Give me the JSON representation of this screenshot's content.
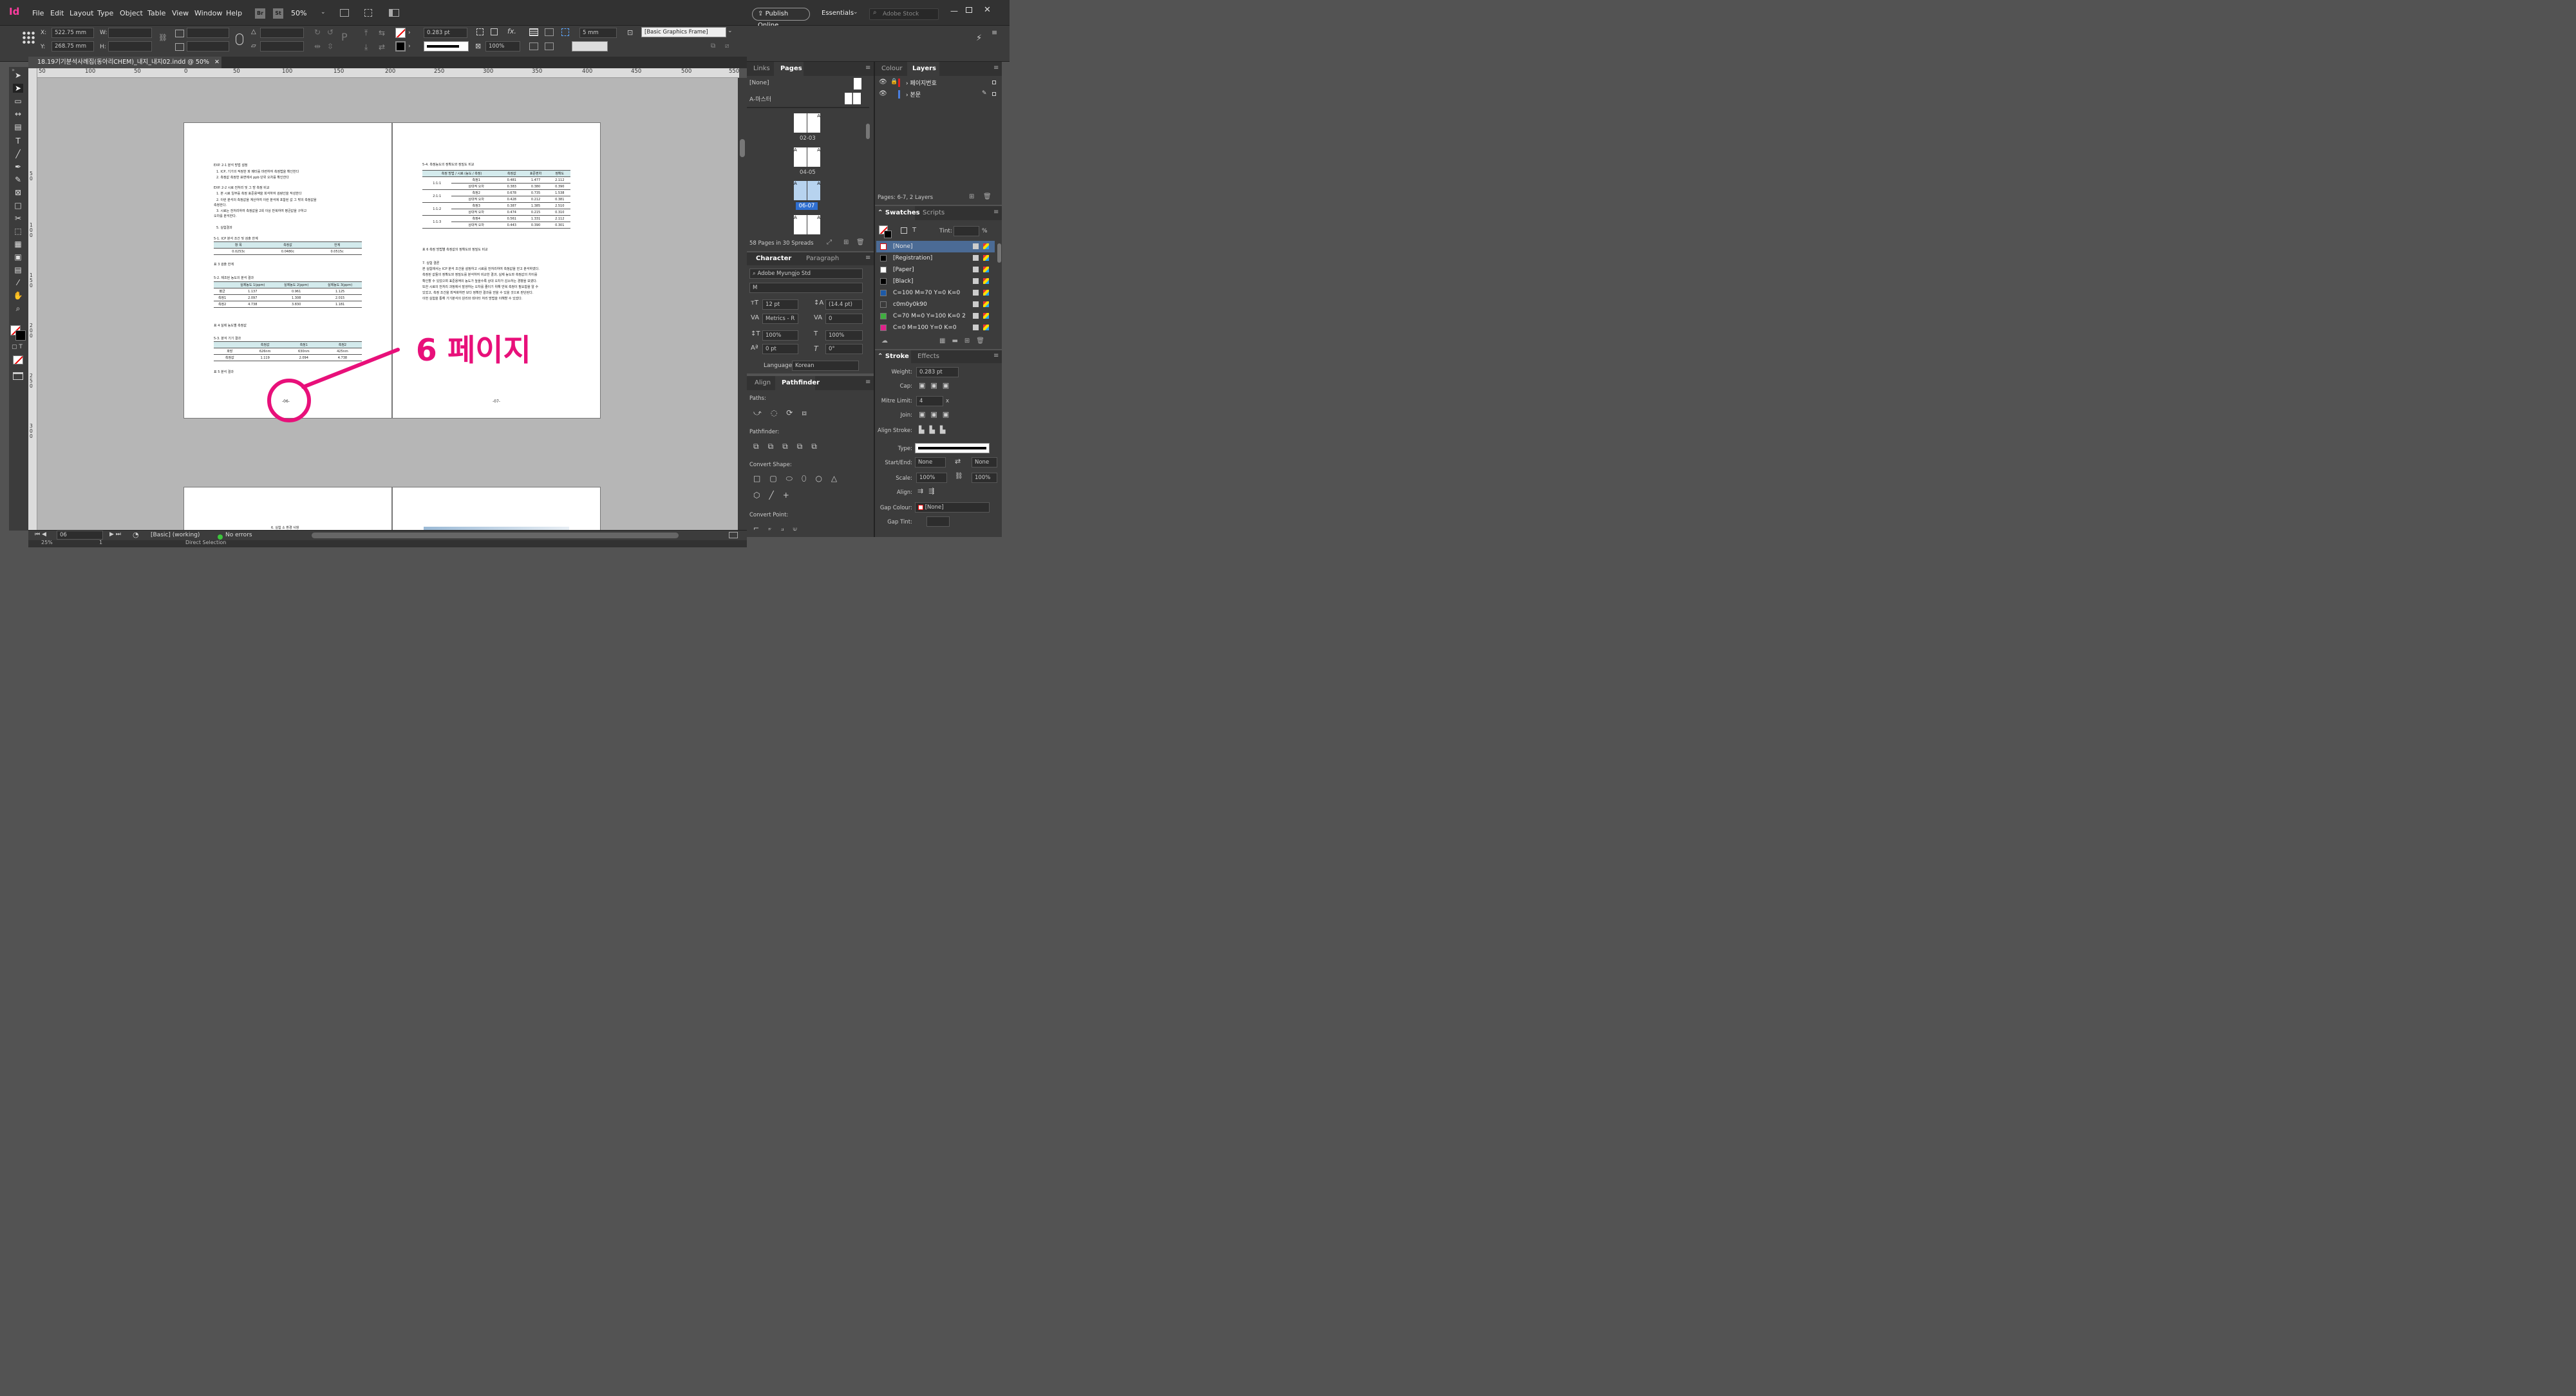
{
  "app": {
    "logo": "Id",
    "menu": [
      "File",
      "Edit",
      "Layout",
      "Type",
      "Object",
      "Table",
      "View",
      "Window",
      "Help"
    ],
    "bridge": "Br",
    "stock": "St",
    "zoom": "50%",
    "publish": "Publish Online",
    "workspace": "Essentials",
    "search_placeholder": "Adobe Stock"
  },
  "control": {
    "x_label": "X:",
    "x": "522.75 mm",
    "y_label": "Y:",
    "y": "268.75 mm",
    "w_label": "W:",
    "h_label": "H:",
    "stroke_weight": "0.283 pt",
    "opacity": "100%",
    "corner": "5 mm",
    "frame_style": "[Basic Graphics Frame]"
  },
  "doc": {
    "tab": "18.19기기분석사례집(동아리CHEM)_내지_내지02.indd @ 50%"
  },
  "rulers": {
    "h": [
      "50",
      "100",
      "50",
      "0",
      "50",
      "100",
      "150",
      "200",
      "250",
      "300",
      "350",
      "400",
      "450",
      "500",
      "550"
    ],
    "v": [
      "5 0",
      "1 0 0",
      "1 5 0",
      "2 0 0",
      "2 5 0",
      "3 0 0"
    ]
  },
  "left_page": {
    "lines": [
      "EXP. 2-1 분석 방법 설정",
      "1. ICP, 기기의 적정한 파 메터를 마련하여 측정법을 확인한다",
      "2. 측정값 측정한 표면에서 ppb 단위 오차를 확인한다",
      "EXP. 2-2 시료 전처리 및 그 방 측정 비교",
      "1. 본 시료 일부를 측정 표준용액을 희석하여 검량선을 작성한다",
      "2. 이런 분석의 측정값을 계산하여 이런 분석에 포함된 값 그 밖의 측정값을",
      "측정한다.",
      "3. 시료는 전처리하여 측정값을 2회 이상 반복하여 평균값을 구하고",
      "오차를 분석한다.",
      "5. 실험결과",
      "5-1. ICP 분석 조건 및 검출 한계",
      "표 3 검출 한계",
      "5-2. 제조된 농도의 분석 결과",
      "표 4 실제 농도별 측정값",
      "5-3. 분석 기기 결과",
      "표 5 분석 결과"
    ],
    "table1": [
      [
        "항 목",
        "측정값",
        "한계"
      ],
      [
        "0.0253c",
        "0.0480c",
        "0.0515c"
      ]
    ],
    "table2": [
      [
        "",
        "실제농도 1(ppm)",
        "실제농도 2(ppm)",
        "실제농도 3(ppm)"
      ],
      [
        "평균",
        "1.137",
        "0.961",
        "1.125"
      ],
      [
        "측정1",
        "2.097",
        "1.308",
        "2.015"
      ],
      [
        "측정2",
        "4.738",
        "3.830",
        "1.181"
      ]
    ],
    "table3": [
      [
        "",
        "측정값",
        "측정1",
        "측정2"
      ],
      [
        "파장",
        "626nm",
        "630nm",
        "425nm"
      ],
      [
        "측정값",
        "1.119",
        "2.094",
        "4.738"
      ]
    ],
    "page_number": "-06-"
  },
  "right_page": {
    "title": "5-4. 측정농도의 정확도와 정밀도 비교",
    "table_head": [
      "측정 방법 / 시료 (농도 / 측정)",
      "측정값",
      "표준편차",
      "정확도"
    ],
    "groups": [
      {
        "name": "1:1:1",
        "rows": [
          [
            "측정1",
            "0.481",
            "1.477",
            "2.112"
          ],
          [
            "상대적 오차",
            "0.383",
            "0.380",
            "0.390"
          ]
        ]
      },
      {
        "name": "2:1:1",
        "rows": [
          [
            "측정2",
            "0.678",
            "0.735",
            "1.538"
          ],
          [
            "상대적 오차",
            "0.428",
            "0.212",
            "0.381"
          ]
        ]
      },
      {
        "name": "1:1:2",
        "rows": [
          [
            "측정3",
            "0.387",
            "1.385",
            "2.510"
          ],
          [
            "상대적 오차",
            "0.474",
            "0.215",
            "0.310"
          ]
        ]
      },
      {
        "name": "1:1:3",
        "rows": [
          [
            "측정4",
            "0.561",
            "1.331",
            "2.112"
          ],
          [
            "상대적 오차",
            "0.443",
            "0.390",
            "0.301"
          ]
        ]
      }
    ],
    "caption": "표 6 측정 방법별 측정값의 정확도와 정밀도 비교",
    "lines": [
      "7. 실험 결론",
      "본 실험에서는 ICP 분석 조건을 설정하고 시료를 전처리하여 측정값을 얻고 분석하였다.",
      "측정된 값들의 정확도와 정밀도를 분석하여 비교한 결과, 실제 농도와 측정값의 차이를",
      "확인할 수 있었으며 표준용액의 농도가 높을수록 상대 오차가 감소하는 경향을 보였다.",
      "또한 시료의 전처리 과정에서 발생하는 오차를 줄이기 위해 반복 측정이 필요함을 알 수",
      "있었고, 측정 조건을 최적화하면 보다 정확한 결과를 얻을 수 있을 것으로 판단된다.",
      "이번 실험을 통해 기기분석의 원리와 데이터 처리 방법을 이해할 수 있었다."
    ],
    "page_number": "-07-"
  },
  "annotation": {
    "text": "6 페이지",
    "color": "#e8107a"
  },
  "bottom_spread": {
    "heading": "6. 실험 소 환경 사항"
  },
  "status": {
    "page": "06",
    "style": "[Basic] (working)",
    "errors": "No errors",
    "zoom": "25%",
    "view": "1",
    "tool": "Direct Selection"
  },
  "pages_panel": {
    "tabs": [
      "Links",
      "Pages"
    ],
    "none": "[None]",
    "master": "A-마스터",
    "spreads": [
      {
        "label": "02-03"
      },
      {
        "label": "04-05"
      },
      {
        "label": "06-07",
        "selected": true
      },
      {
        "label": ""
      }
    ],
    "footer": "58 Pages in 30 Spreads"
  },
  "layers_panel": {
    "tabs": [
      "Colour",
      "Layers"
    ],
    "layers": [
      {
        "name": "페이지번호",
        "color": "#e02020"
      },
      {
        "name": "본문",
        "color": "#4a7fe0"
      }
    ],
    "footer": "Pages: 6-7, 2 Layers"
  },
  "character": {
    "tabs": [
      "Character",
      "Paragraph"
    ],
    "font": "Adobe Myungjo Std",
    "style": "M",
    "size": "12 pt",
    "leading": "(14.4 pt)",
    "kerning": "Metrics - R",
    "tracking": "0",
    "vscale": "100%",
    "hscale": "100%",
    "baseline": "0 pt",
    "skew": "0°",
    "language_label": "Language:",
    "language": "Korean"
  },
  "pathfinder": {
    "tabs": [
      "Align",
      "Pathfinder"
    ],
    "paths": "Paths:",
    "pathfinder": "Pathfinder:",
    "convert_shape": "Convert Shape:",
    "convert_point": "Convert Point:"
  },
  "swatches": {
    "tabs": [
      "Swatches",
      "Scripts"
    ],
    "tint_label": "Tint:",
    "tint_unit": "%",
    "items": [
      {
        "name": "[None]",
        "color": "none",
        "selected": true
      },
      {
        "name": "[Registration]",
        "color": "#000000"
      },
      {
        "name": "[Paper]",
        "color": "#ffffff"
      },
      {
        "name": "[Black]",
        "color": "#000000"
      },
      {
        "name": "C=100 M=70 Y=0 K=0",
        "color": "#1d5aa8"
      },
      {
        "name": "c0m0y0k90",
        "color": "#3a3a3a"
      },
      {
        "name": "C=70 M=0 Y=100 K=0 2",
        "color": "#3fae3f"
      },
      {
        "name": "C=0 M=100 Y=0 K=0",
        "color": "#e0218a"
      }
    ]
  },
  "stroke": {
    "tabs": [
      "Stroke",
      "Effects"
    ],
    "weight_label": "Weight:",
    "weight": "0.283 pt",
    "cap_label": "Cap:",
    "mitre_label": "Mitre Limit:",
    "mitre": "4",
    "mitre_x": "x",
    "join_label": "Join:",
    "align_label": "Align Stroke:",
    "type_label": "Type:",
    "startend_label": "Start/End:",
    "start": "None",
    "end": "None",
    "scale_label": "Scale:",
    "scale1": "100%",
    "scale2": "100%",
    "align2_label": "Align:",
    "gap_colour_label": "Gap Colour:",
    "gap_colour": "[None]",
    "gap_tint_label": "Gap Tint:"
  }
}
